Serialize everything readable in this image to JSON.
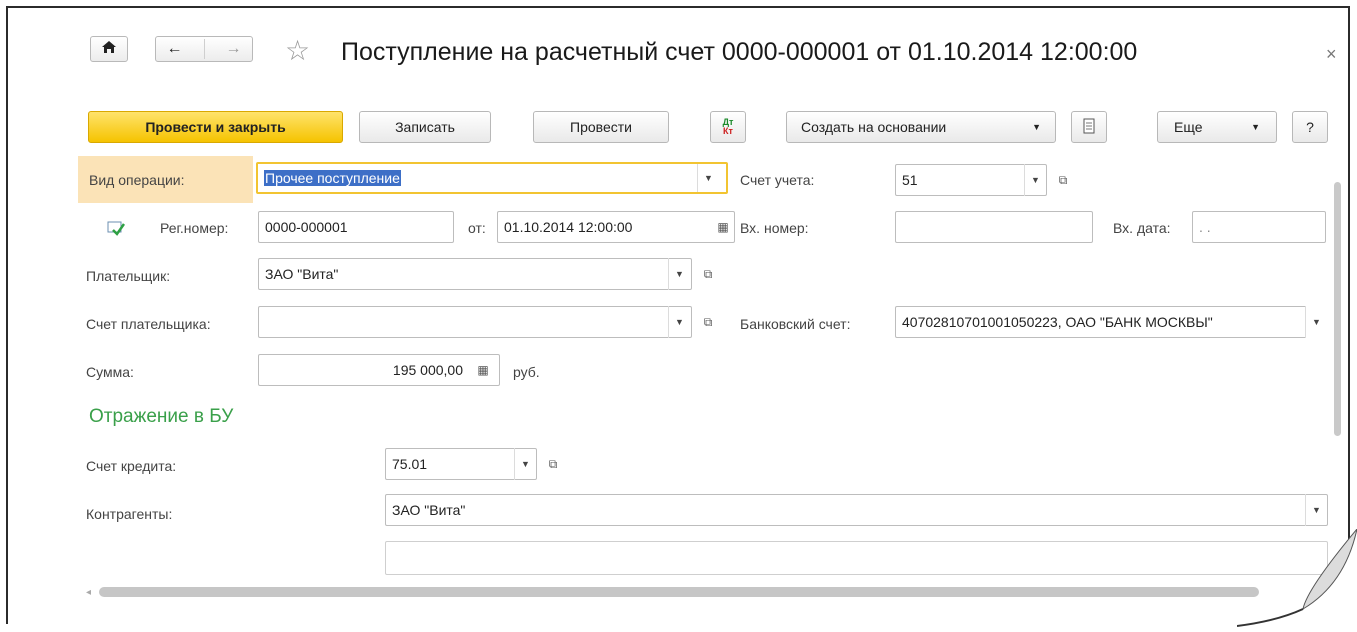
{
  "window": {
    "title": "Поступление на расчетный счет 0000-000001 от 01.10.2014 12:00:00",
    "close_glyph": "×"
  },
  "nav": {
    "home": "⌂",
    "back": "←",
    "forward": "→",
    "star": "☆"
  },
  "toolbar": {
    "post_close": "Провести и закрыть",
    "save": "Записать",
    "post": "Провести",
    "dtkt_top": "Дт",
    "dtkt_bottom": "Кт",
    "create_based": "Создать на основании",
    "more": "Еще",
    "help": "?"
  },
  "form": {
    "operation_type": {
      "label": "Вид операции:",
      "value": "Прочее поступление"
    },
    "account": {
      "label": "Счет учета:",
      "value": "51"
    },
    "reg_number": {
      "label": "Рег.номер:",
      "value": "0000-000001"
    },
    "date": {
      "label": "от:",
      "value": "01.10.2014 12:00:00"
    },
    "in_number": {
      "label": "Вх. номер:",
      "value": ""
    },
    "in_date": {
      "label": "Вх. дата:",
      "value": " .  ."
    },
    "payer": {
      "label": "Плательщик:",
      "value": "ЗАО \"Вита\""
    },
    "payer_account": {
      "label": "Счет плательщика:",
      "value": ""
    },
    "bank_account": {
      "label": "Банковский счет:",
      "value": "40702810701001050223, ОАО \"БАНК МОСКВЫ\""
    },
    "amount": {
      "label": "Сумма:",
      "value": "195 000,00",
      "currency": "руб."
    }
  },
  "accounting": {
    "section_title": "Отражение в БУ",
    "credit_account": {
      "label": "Счет кредита:",
      "value": "75.01"
    },
    "counterparties": {
      "label": "Контрагенты:",
      "value": "ЗАО \"Вита\""
    },
    "extra": {
      "value": ""
    }
  }
}
